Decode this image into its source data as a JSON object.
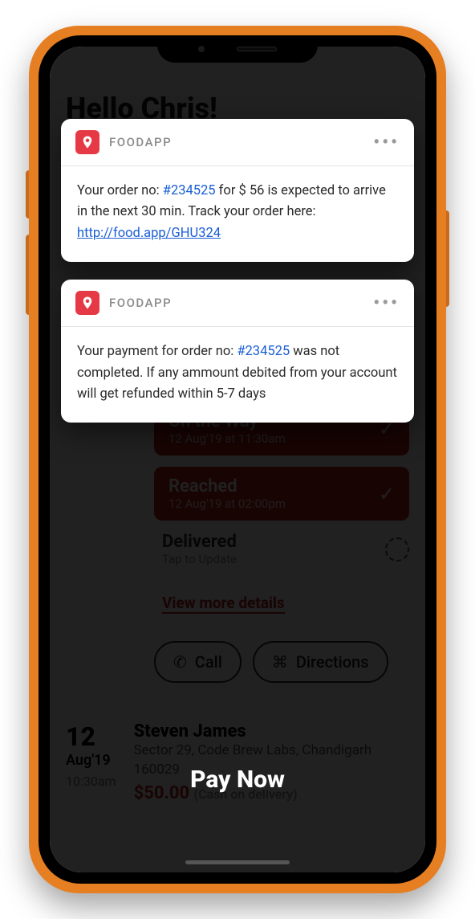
{
  "app_brand": "FOODAPP",
  "notifications": [
    {
      "pre": "Your order no: ",
      "order_no": "#234525",
      "mid": " for $ 56  is expected to arrive  in the next 30 min. Track your order here: ",
      "link": "http://food.app/GHU324"
    },
    {
      "pre": "Your payment for order no: ",
      "order_no": "#234525",
      "post": "  was not completed.  If any ammount debited from your account will get refunded within 5-7 days"
    }
  ],
  "greeting": "Hello Chris!",
  "status": {
    "onway": {
      "title": "On the Way",
      "sub": "12 Aug'19 at 11:30am"
    },
    "reached": {
      "title": "Reached",
      "sub": "12 Aug'19 at 02:00pm"
    },
    "delivered": {
      "title": "Delivered",
      "sub": "Tap to Update"
    }
  },
  "view_more": "View more details",
  "actions": {
    "call": "Call",
    "directions": "Directions"
  },
  "order": {
    "day": "12",
    "month": "Aug'19",
    "time": "10:30am",
    "name": "Steven James",
    "addr": "Sector 29, Code Brew Labs, Chandigarh 160029",
    "price": "$50.00",
    "method": "(Cash on delivery)"
  },
  "cta": "Pay Now"
}
